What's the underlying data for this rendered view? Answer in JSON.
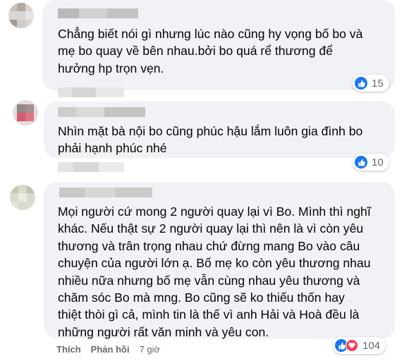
{
  "comments": [
    {
      "text": "Chẳng biết nói gì nhưng lúc nào cũng hy vọng bố bo và\nmẹ bo quay về bên nhau.bởi bo quá rể thương để\nhưởng hp trọn vẹn.",
      "reaction_count": "15",
      "reactions": [
        "like-icon"
      ]
    },
    {
      "text": "Nhìn mặt bà nội bo cũng phúc hậu lắm luôn gia đình bo\nphải hạnh phúc nhé",
      "reaction_count": "10",
      "reactions": [
        "like-icon"
      ]
    },
    {
      "text": "Mọi người cứ mong 2 người quay lại vì Bo. Mình thì nghĩ\nkhác. Nếu thật sự 2 người quay lại thì nên là vì còn yêu\nthương và trân trọng nhau chứ đừng mang Bo vào câu\nchuyện của người lớn ạ. Bố mẹ ko còn yêu thương nhau\nnhiều nữa nhưng bố mẹ vẫn cùng nhau yêu thương và\nchăm sóc Bo mà mng. Bo cũng sẽ ko thiếu thốn hay\nthiệt thòi gì cả, mình tin là thế vì anh Hải và Hoà đều là\nnhững người rất văn minh và yêu con.",
      "reaction_count": "104",
      "reactions": [
        "like-icon",
        "heart-icon"
      ]
    }
  ],
  "actions": {
    "like": "Thích",
    "reply": "Phản hồi",
    "time": "7 giờ"
  },
  "colors": {
    "bubble": "#f0f2f5",
    "like_blue": "#1877f2",
    "love_red": "#f33e58",
    "meta_gray": "#65676b"
  }
}
